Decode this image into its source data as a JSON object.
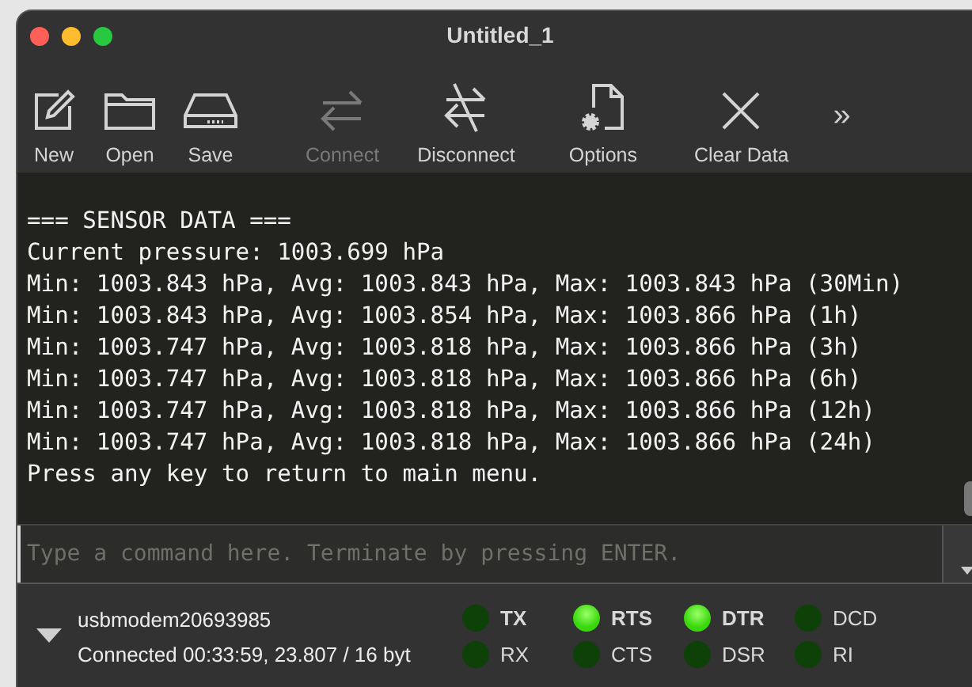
{
  "window": {
    "title": "Untitled_1"
  },
  "toolbar": [
    {
      "kind": "new",
      "label": "New",
      "disabled": false
    },
    {
      "kind": "open",
      "label": "Open",
      "disabled": false
    },
    {
      "kind": "save",
      "label": "Save",
      "disabled": false
    },
    {
      "kind": "connect",
      "label": "Connect",
      "disabled": true
    },
    {
      "kind": "disconnect",
      "label": "Disconnect",
      "disabled": false
    },
    {
      "kind": "options",
      "label": "Options",
      "disabled": false
    },
    {
      "kind": "clear",
      "label": "Clear Data",
      "disabled": false
    }
  ],
  "toolbar_overflow": "»",
  "terminal": {
    "lines": [
      "=== SENSOR DATA ===",
      "Current pressure: 1003.699 hPa",
      "Min: 1003.843 hPa, Avg: 1003.843 hPa, Max: 1003.843 hPa (30Min)",
      "Min: 1003.843 hPa, Avg: 1003.854 hPa, Max: 1003.866 hPa (1h)",
      "Min: 1003.747 hPa, Avg: 1003.818 hPa, Max: 1003.866 hPa (3h)",
      "Min: 1003.747 hPa, Avg: 1003.818 hPa, Max: 1003.866 hPa (6h)",
      "Min: 1003.747 hPa, Avg: 1003.818 hPa, Max: 1003.866 hPa (12h)",
      "Min: 1003.747 hPa, Avg: 1003.818 hPa, Max: 1003.866 hPa (24h)",
      "Press any key to return to main menu."
    ]
  },
  "command": {
    "placeholder": "Type a command here. Terminate by pressing ENTER."
  },
  "status": {
    "port": "usbmodem20693985",
    "info": "Connected 00:33:59, 23.807 / 16 byt"
  },
  "signals": [
    {
      "label": "TX",
      "on": false,
      "kind": "output"
    },
    {
      "label": "RTS",
      "on": true,
      "kind": "output"
    },
    {
      "label": "DTR",
      "on": true,
      "kind": "output"
    },
    {
      "label": "DCD",
      "on": false,
      "kind": "input"
    },
    {
      "label": "RX",
      "on": false,
      "kind": "input"
    },
    {
      "label": "CTS",
      "on": false,
      "kind": "input"
    },
    {
      "label": "DSR",
      "on": false,
      "kind": "input"
    },
    {
      "label": "RI",
      "on": false,
      "kind": "input"
    }
  ]
}
